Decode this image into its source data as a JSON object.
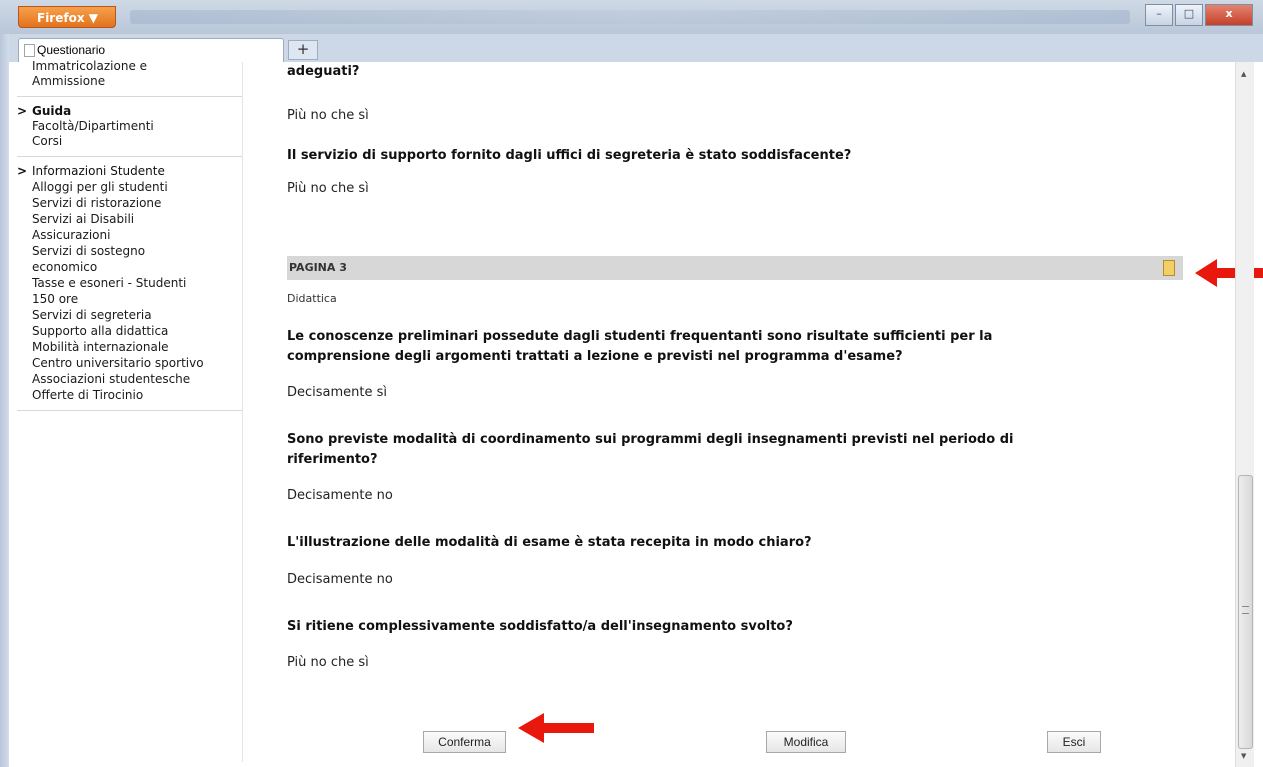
{
  "browser": {
    "menu_label": "Firefox ▼",
    "tab_title": "Questionario",
    "new_tab_symbol": "+",
    "controls": {
      "minimize": "–",
      "maximize": "□",
      "close": "x"
    }
  },
  "sidebar": {
    "top_items": [
      "Immatricolazione e",
      "Ammissione"
    ],
    "groups": [
      {
        "heading": "Guida",
        "items": [
          "Facoltà/Dipartimenti",
          "Corsi"
        ]
      },
      {
        "heading": "Informazioni Studente",
        "items": [
          "Alloggi per gli studenti",
          "Servizi di ristorazione",
          "Servizi ai Disabili",
          "Assicurazioni",
          "Servizi di sostegno",
          "economico",
          "Tasse e esoneri - Studenti",
          "150 ore",
          "Servizi di segreteria",
          "Supporto alla didattica",
          "Mobilità internazionale",
          "Centro universitario sportivo",
          "Associazioni studentesche",
          "Offerte di Tirocinio"
        ]
      }
    ]
  },
  "main": {
    "top_question_tail": "adeguati?",
    "top_answer": "Più no che sì",
    "q_segreteria": "Il servizio di supporto fornito dagli uffici di segreteria è stato soddisfacente?",
    "a_segreteria": "Più no che sì",
    "section_title": "PAGINA 3",
    "section_subtitle": "Didattica",
    "questions": [
      {
        "line1": "Le conoscenze preliminari possedute dagli studenti frequentanti sono risultate sufficienti per la",
        "line2": "comprensione degli argomenti trattati a lezione e previsti nel programma d'esame?",
        "answer": "Decisamente sì"
      },
      {
        "line1": "Sono previste modalità di coordinamento sui programmi degli insegnamenti previsti nel periodo di",
        "line2": "riferimento?",
        "answer": "Decisamente no"
      },
      {
        "line1": "L'illustrazione delle modalità di esame è stata recepita in modo chiaro?",
        "line2": "",
        "answer": "Decisamente no"
      },
      {
        "line1": "Si ritiene complessivamente soddisfatto/a dell'insegnamento svolto?",
        "line2": "",
        "answer": "Più no che sì"
      }
    ],
    "buttons": {
      "confirm": "Conferma",
      "edit": "Modifica",
      "exit": "Esci"
    }
  },
  "colors": {
    "annotation_arrow": "#e8180c",
    "section_bar": "#d7d7d7"
  }
}
